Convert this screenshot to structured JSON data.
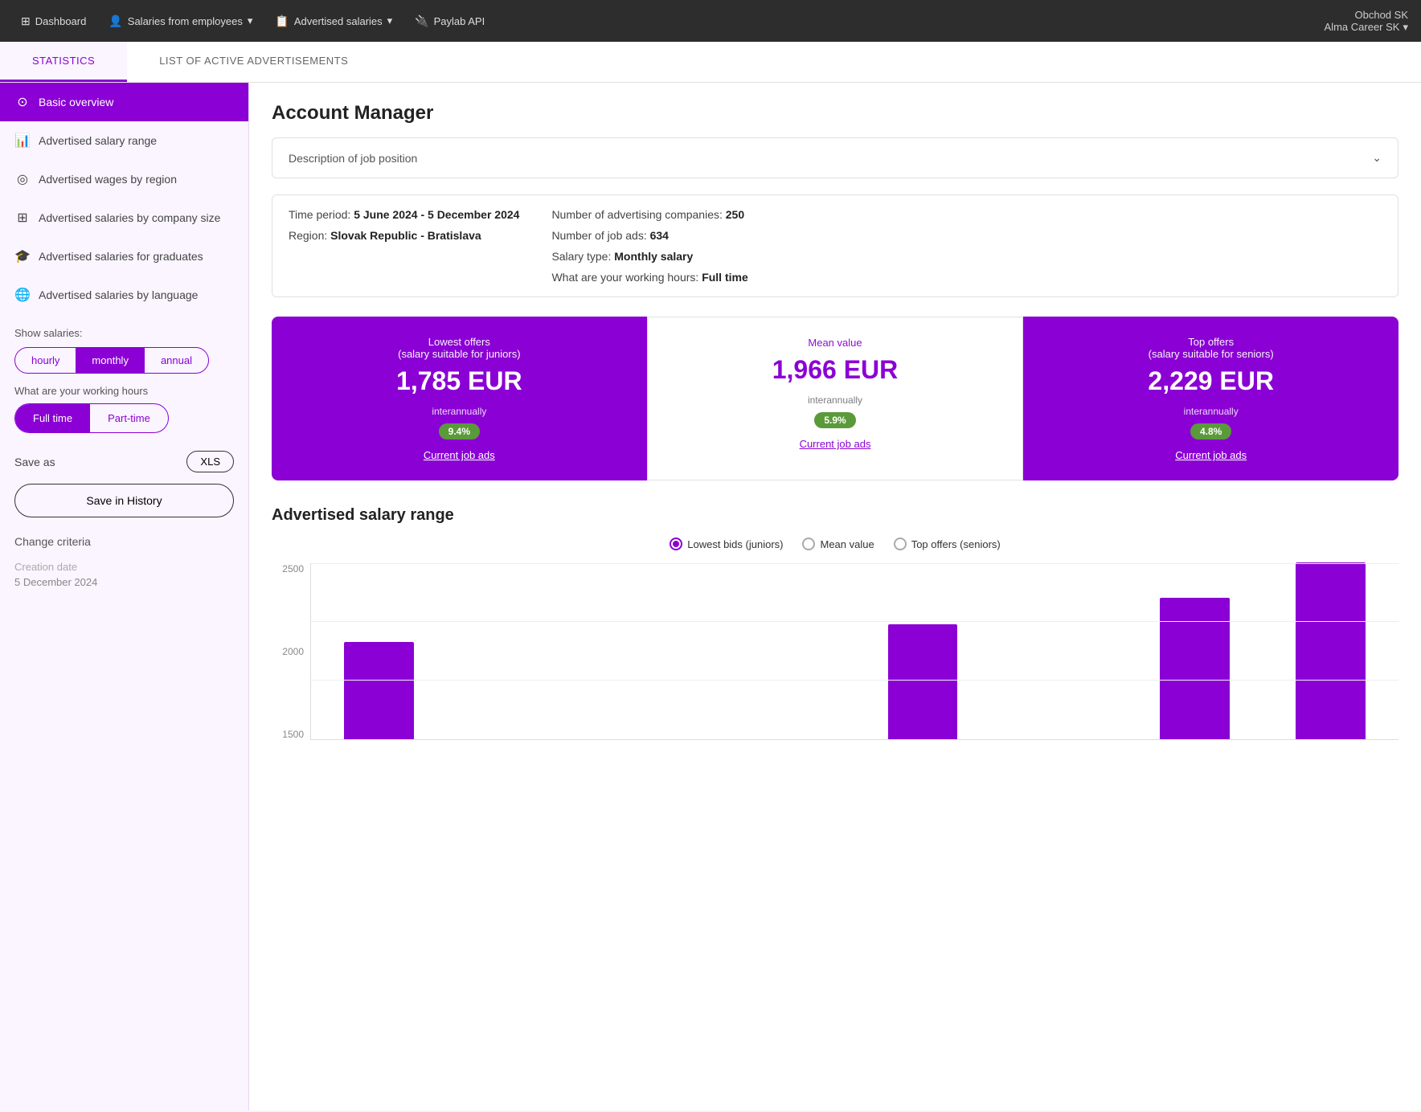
{
  "topNav": {
    "items": [
      {
        "label": "Dashboard",
        "icon": "⊞"
      },
      {
        "label": "Salaries from employees",
        "icon": "👤",
        "hasDropdown": true
      },
      {
        "label": "Advertised salaries",
        "icon": "📋",
        "hasDropdown": true
      },
      {
        "label": "Paylab API",
        "icon": "🔌"
      }
    ],
    "company": "Obchod SK",
    "user": "Alma Career SK"
  },
  "tabs": [
    {
      "label": "STATISTICS",
      "active": true
    },
    {
      "label": "LIST OF ACTIVE ADVERTISEMENTS",
      "active": false
    }
  ],
  "sidebar": {
    "items": [
      {
        "label": "Basic overview",
        "icon": "⊙",
        "active": true
      },
      {
        "label": "Advertised salary range",
        "icon": "📊",
        "active": false
      },
      {
        "label": "Advertised wages by region",
        "icon": "◎",
        "active": false
      },
      {
        "label": "Advertised salaries by company size",
        "icon": "⊞",
        "active": false
      },
      {
        "label": "Advertised salaries for graduates",
        "icon": "🎓",
        "active": false
      },
      {
        "label": "Advertised salaries by language",
        "icon": "🌐",
        "active": false
      }
    ],
    "showSalariesLabel": "Show salaries:",
    "salaryToggle": {
      "options": [
        "hourly",
        "monthly",
        "annual"
      ],
      "active": "monthly"
    },
    "workingHoursLabel": "What are your working hours",
    "workingHoursToggle": {
      "options": [
        "Full time",
        "Part-time"
      ],
      "active": "Full time"
    },
    "saveAsLabel": "Save as",
    "saveAsBtn": "XLS",
    "saveHistoryBtn": "Save in History",
    "changeCriteriaLabel": "Change criteria",
    "creationDateLabel": "Creation date",
    "creationDateValue": "5 December 2024"
  },
  "main": {
    "title": "Account Manager",
    "descriptionLabel": "Description of job position",
    "infoLeft": [
      {
        "label": "Time period: ",
        "value": "5 June 2024 - 5 December 2024"
      },
      {
        "label": "Region: ",
        "value": "Slovak Republic - Bratislava"
      }
    ],
    "infoRight": [
      {
        "label": "Number of advertising companies: ",
        "value": "250"
      },
      {
        "label": "Number of job ads: ",
        "value": "634"
      },
      {
        "label": "Salary type: ",
        "value": "Monthly salary"
      },
      {
        "label": "What are your working hours: ",
        "value": "Full time"
      }
    ],
    "salaryCards": [
      {
        "title": "Lowest offers",
        "subtitle2": "(salary suitable for juniors)",
        "value": "1,785 EUR",
        "interannually": "interannually",
        "badge": "9.4%",
        "link": "Current job ads",
        "type": "dark"
      },
      {
        "title": "Mean value",
        "value": "1,966 EUR",
        "interannually": "interannually",
        "badge": "5.9%",
        "link": "Current job ads",
        "type": "light"
      },
      {
        "title": "Top offers",
        "subtitle2": "(salary suitable for seniors)",
        "value": "2,229 EUR",
        "interannually": "interannually",
        "badge": "4.8%",
        "link": "Current job ads",
        "type": "dark"
      }
    ],
    "chart": {
      "title": "Advertised salary range",
      "legend": [
        {
          "label": "Lowest bids (juniors)",
          "selected": true
        },
        {
          "label": "Mean value",
          "selected": false
        },
        {
          "label": "Top offers (seniors)",
          "selected": false
        }
      ],
      "yLabels": [
        "2500",
        "2000",
        "1500"
      ],
      "bars": [
        0.55,
        0,
        0,
        0,
        0.65,
        0,
        0.8,
        1.0
      ]
    }
  }
}
